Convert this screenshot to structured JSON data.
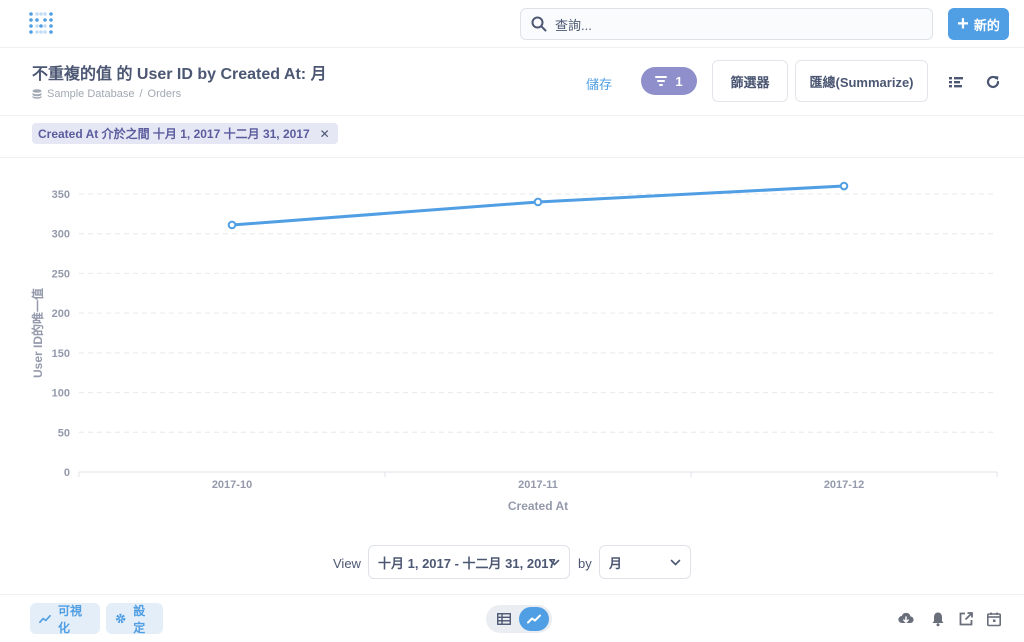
{
  "nav": {
    "search_placeholder": "查詢...",
    "new_button_label": "新的"
  },
  "header": {
    "title": "不重複的值 的 User ID by Created At: 月",
    "breadcrumb": {
      "database": "Sample Database",
      "separator": "/",
      "table": "Orders"
    },
    "save_label": "儲存",
    "filter_count": "1",
    "filter_button_label": "篩選器",
    "summarize_button_label": "匯總(Summarize)"
  },
  "filter_chip": {
    "label": "Created At 介於之間 十月 1, 2017 十二月 31, 2017",
    "remove_glyph": "✕"
  },
  "chart_data": {
    "type": "line",
    "categories": [
      "2017-10",
      "2017-11",
      "2017-12"
    ],
    "series": [
      {
        "values": [
          311,
          340,
          360
        ],
        "color": "#509ee3"
      }
    ],
    "xlabel": "Created At",
    "ylabel": "User ID的唯一值",
    "ylim": [
      0,
      350
    ],
    "yticks": [
      0,
      50,
      100,
      150,
      200,
      250,
      300,
      350
    ],
    "grid": true
  },
  "view_controls": {
    "view_label": "View",
    "range_value": "十月 1, 2017 - 十二月 31, 2017",
    "by_label": "by",
    "unit_value": "月"
  },
  "footer": {
    "visualize_label": "可視化",
    "settings_label": "設定"
  },
  "colors": {
    "brand": "#509ee3",
    "filter_accent": "#8e8fcb",
    "text": "#4c5773"
  },
  "icons": {
    "logo": "metabase-logo-icon",
    "search": "search-icon",
    "new": "plus-icon",
    "filter": "filter-icon",
    "notebook": "notebook-icon",
    "refresh": "refresh-icon",
    "chevron": "chevron-down-icon",
    "download": "download-icon",
    "alert": "bell-icon",
    "share": "share-icon",
    "schedule": "calendar-icon",
    "table_view": "table-icon",
    "chart_view": "line-chart-icon",
    "settings": "gear-icon"
  }
}
